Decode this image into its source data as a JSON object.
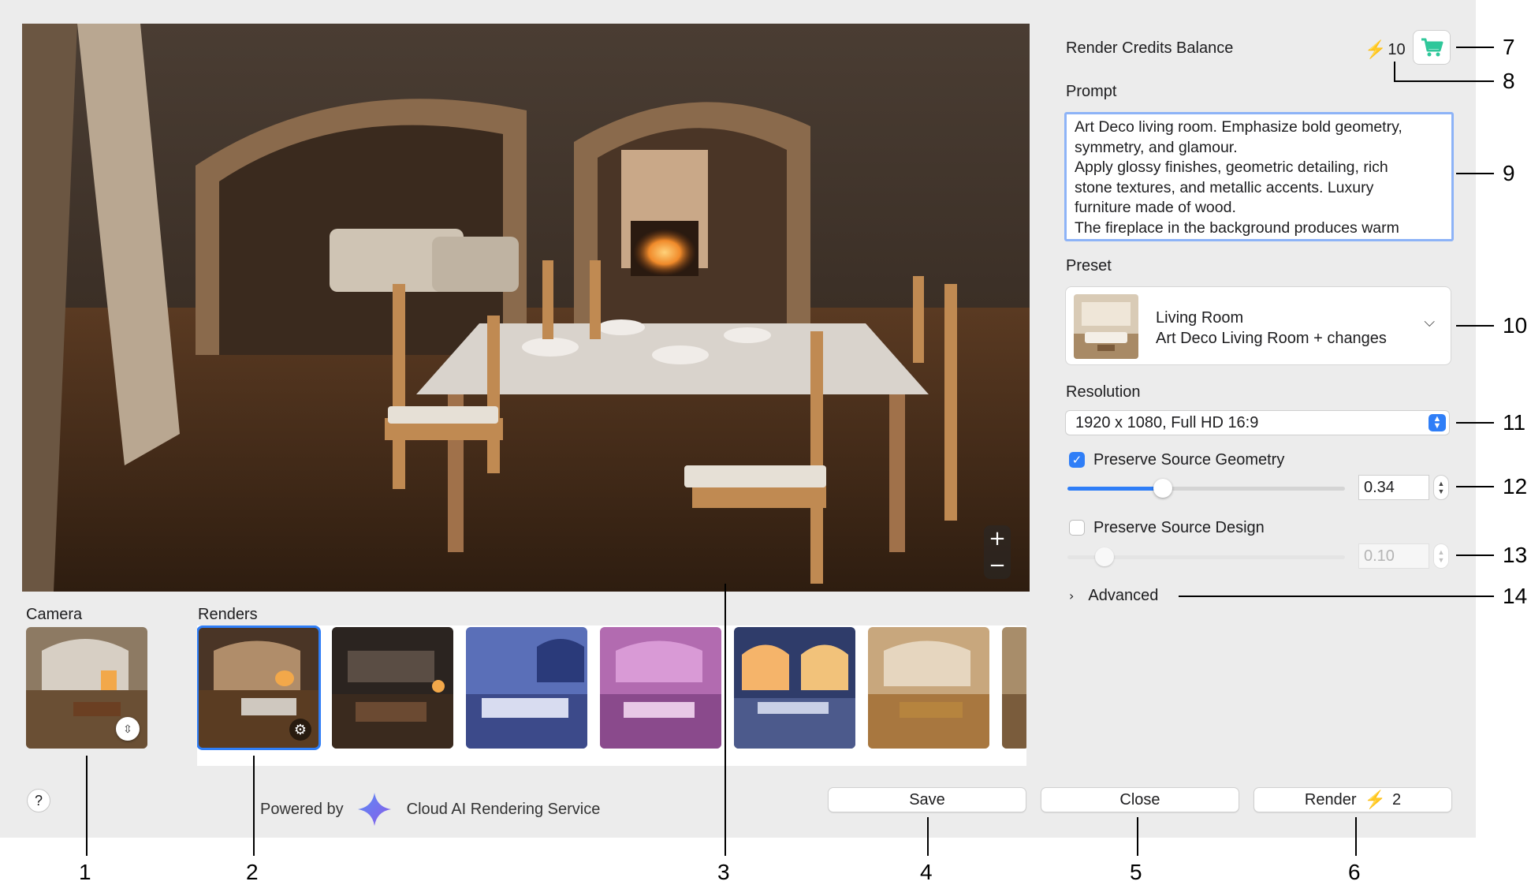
{
  "main": {
    "camera_label": "Camera",
    "renders_label": "Renders",
    "zoom_in": "+",
    "zoom_out": "−"
  },
  "footer": {
    "help": "?",
    "powered_by": "Powered by",
    "service": "Cloud AI Rendering Service",
    "save": "Save",
    "close": "Close",
    "render": "Render",
    "render_cost": "2"
  },
  "sidebar": {
    "credits_label": "Render Credits Balance",
    "credits_value": "10",
    "prompt_label": "Prompt",
    "prompt_lines": [
      "Art Deco living room. Emphasize bold geometry,",
      "symmetry, and glamour.",
      "Apply glossy finishes, geometric detailing, rich",
      "stone textures, and metallic accents. Luxury",
      "furniture made of wood.",
      "The fireplace in the background produces warm"
    ],
    "preset_label": "Preset",
    "preset_title": "Living Room",
    "preset_subtitle": "Art Deco Living Room + changes",
    "resolution_label": "Resolution",
    "resolution_value": "1920 x 1080, Full HD 16:9",
    "geometry_label": "Preserve Source Geometry",
    "geometry_checked": true,
    "geometry_value": "0.34",
    "design_label": "Preserve Source Design",
    "design_checked": false,
    "design_value": "0.10",
    "advanced_label": "Advanced"
  },
  "callouts": [
    "1",
    "2",
    "3",
    "4",
    "5",
    "6",
    "7",
    "8",
    "9",
    "10",
    "11",
    "12",
    "13",
    "14"
  ],
  "colors": {
    "accent": "#2f7ef7",
    "bolt": "#f2b400",
    "cart": "#2fc79a"
  }
}
